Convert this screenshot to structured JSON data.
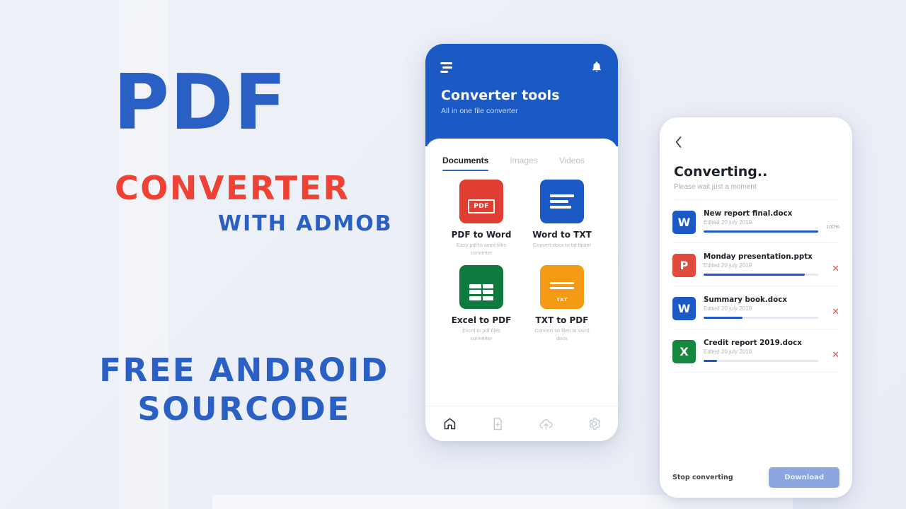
{
  "promo": {
    "line1": "PDF",
    "line2": "CONVERTER",
    "line3": "WITH ADMOB",
    "line4a": "FREE ANDROID",
    "line4b": "SOURCODE",
    "colors": {
      "blue": "#2a5fc4",
      "red": "#ef4235"
    }
  },
  "phone1": {
    "menu_icon": "hamburger-icon",
    "bell_icon": "bell-icon",
    "title": "Converter tools",
    "subtitle": "All in one file converter",
    "tabs": [
      {
        "label": "Documents",
        "active": true
      },
      {
        "label": "Images",
        "active": false
      },
      {
        "label": "Videos",
        "active": false
      }
    ],
    "tools": [
      {
        "name": "PDF to Word",
        "desc": "Easy pdf to word files converter",
        "color": "#e03e32",
        "glyph": "pdf-badge-icon"
      },
      {
        "name": "Word to TXT",
        "desc": "Convert docx to txt faster",
        "color": "#1b59c4",
        "glyph": "text-lines-icon"
      },
      {
        "name": "Excel to PDF",
        "desc": "Excel to pdf files converter",
        "color": "#0f7a3d",
        "glyph": "spreadsheet-icon"
      },
      {
        "name": "TXT to PDF",
        "desc": "Convert txt files to word docx",
        "color": "#f59a14",
        "glyph": "txt-badge-icon"
      }
    ],
    "nav": [
      {
        "icon": "home-icon",
        "active": true
      },
      {
        "icon": "file-add-icon",
        "active": false
      },
      {
        "icon": "cloud-upload-icon",
        "active": false
      },
      {
        "icon": "gear-icon",
        "active": false
      }
    ]
  },
  "phone2": {
    "back_icon": "chevron-left-icon",
    "title": "Converting..",
    "subtitle": "Please wait just a moment",
    "files": [
      {
        "name": "New report final.docx",
        "edited": "Edited 20 july 2019",
        "icon_letter": "W",
        "icon_color": "#1b59c4",
        "progress": 100,
        "status_text": "100%",
        "has_cancel": false
      },
      {
        "name": "Monday presentation.pptx",
        "edited": "Edited 20 july 2019",
        "icon_letter": "P",
        "icon_color": "#e04b3c",
        "progress": 88,
        "status_text": "",
        "has_cancel": true
      },
      {
        "name": "Summary book.docx",
        "edited": "Edited 20 july 2019",
        "icon_letter": "W",
        "icon_color": "#1b59c4",
        "progress": 34,
        "status_text": "",
        "has_cancel": true
      },
      {
        "name": "Credit report 2019.docx",
        "edited": "Edited 20 july 2019",
        "icon_letter": "X",
        "icon_color": "#14883f",
        "progress": 12,
        "status_text": "",
        "has_cancel": true
      }
    ],
    "stop_label": "Stop converting",
    "download_label": "Download"
  }
}
